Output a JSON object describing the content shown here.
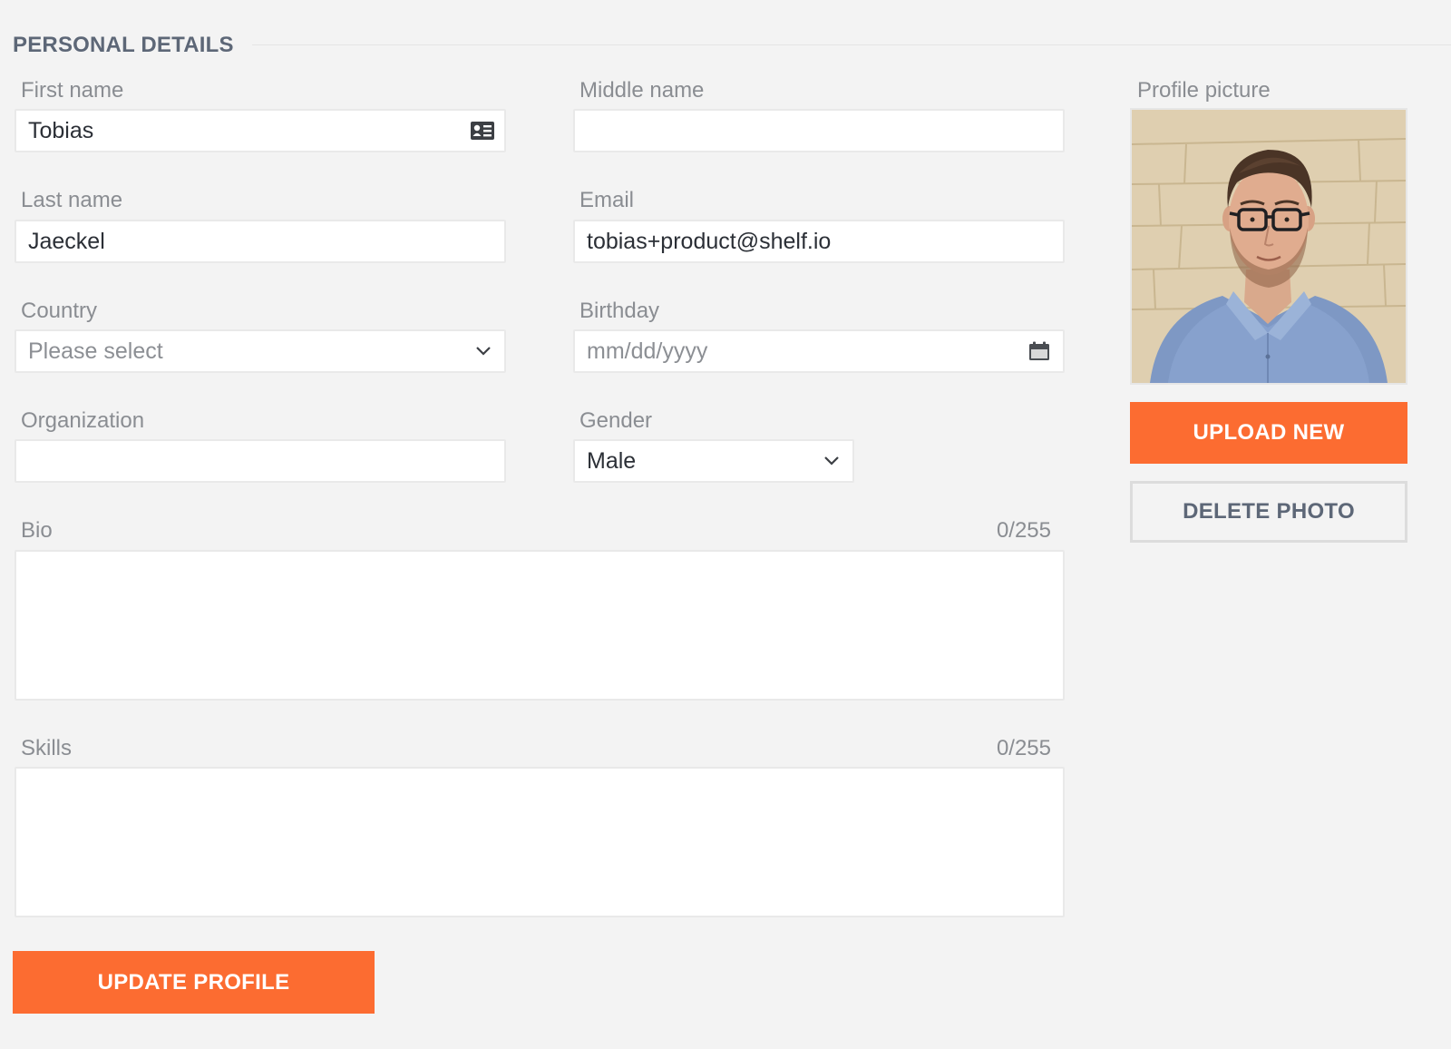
{
  "section": {
    "title": "PERSONAL DETAILS"
  },
  "fields": {
    "first_name": {
      "label": "First name",
      "value": "Tobias",
      "placeholder": ""
    },
    "middle_name": {
      "label": "Middle name",
      "value": "",
      "placeholder": ""
    },
    "last_name": {
      "label": "Last name",
      "value": "Jaeckel",
      "placeholder": ""
    },
    "email": {
      "label": "Email",
      "value": "tobias+product@shelf.io",
      "placeholder": ""
    },
    "country": {
      "label": "Country",
      "selected": "Please select"
    },
    "birthday": {
      "label": "Birthday",
      "value": "",
      "placeholder": "mm/dd/yyyy"
    },
    "organization": {
      "label": "Organization",
      "value": "",
      "placeholder": ""
    },
    "gender": {
      "label": "Gender",
      "selected": "Male"
    },
    "bio": {
      "label": "Bio",
      "counter": "0/255",
      "value": ""
    },
    "skills": {
      "label": "Skills",
      "counter": "0/255",
      "value": ""
    }
  },
  "profile_picture": {
    "label": "Profile picture",
    "upload_label": "UPLOAD NEW",
    "delete_label": "DELETE PHOTO"
  },
  "actions": {
    "update_label": "UPDATE PROFILE"
  },
  "icons": {
    "first_name_suffix": "contact-card-icon",
    "country_suffix": "chevron-down-icon",
    "birthday_suffix": "calendar-icon",
    "gender_suffix": "chevron-down-icon"
  },
  "colors": {
    "accent": "#fc6c31",
    "heading": "#5d6777",
    "label": "#8a8d92",
    "background": "#f3f3f3"
  }
}
